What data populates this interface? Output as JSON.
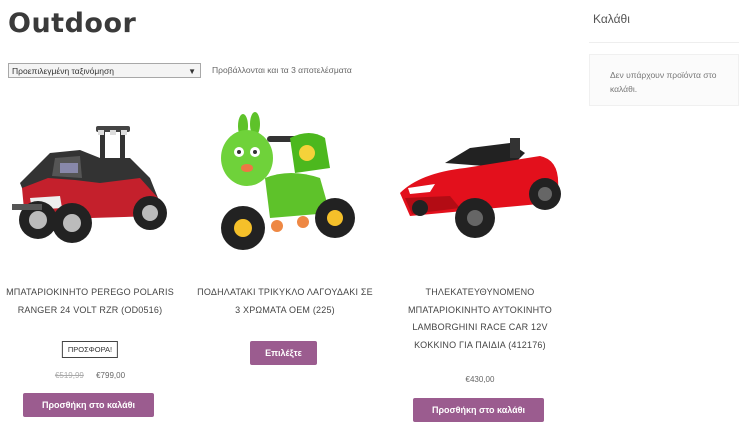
{
  "page": {
    "title": "Outdoor"
  },
  "toolbar": {
    "sort_selected": "Προεπιλεγμένη ταξινόμηση",
    "result_count": "Προβάλλονται και τα 3 αποτελέσματα"
  },
  "cart": {
    "title": "Καλάθι",
    "empty_message": "Δεν υπάρχουν προϊόντα στο καλάθι."
  },
  "products": [
    {
      "title": "ΜΠΑΤΑΡΙΟΚΙΝΗΤΟ PEREGO POLARIS RANGER 24 VOLT RZR (OD0516)",
      "badge": "ΠΡΟΣΦΟΡΑ!",
      "price_old": "€519,99",
      "price_new": "€799,00",
      "button": "Προσθήκη στο καλάθι",
      "image_icon": "red-ride-on-buggy-image"
    },
    {
      "title": "ΠΟΔΗΛΑΤΑΚΙ ΤΡΙΚΥΚΛΟ ΛΑΓΟΥΔΑΚΙ ΣΕ 3 ΧΡΩΜΑΤΑ OEM (225)",
      "button": "Επιλέξτε",
      "image_icon": "green-bunny-tricycle-image"
    },
    {
      "title": "ΤΗΛΕΚΑΤΕΥΘΥΝΟΜΕΝΟ ΜΠΑΤΑΡΙΟΚΙΝΗΤΟ ΑΥΤΟΚΙΝΗΤΟ LAMBORGHINI RACE CAR 12V ΚΟΚΚΙΝΟ ΓΙΑ ΠΑΙΔΙΑ (412176)",
      "price": "€430,00",
      "button": "Προσθήκη στο καλάθι",
      "image_icon": "red-sports-car-image"
    }
  ],
  "colors": {
    "button": "#9b5c8f",
    "title": "#3a3a3a"
  }
}
